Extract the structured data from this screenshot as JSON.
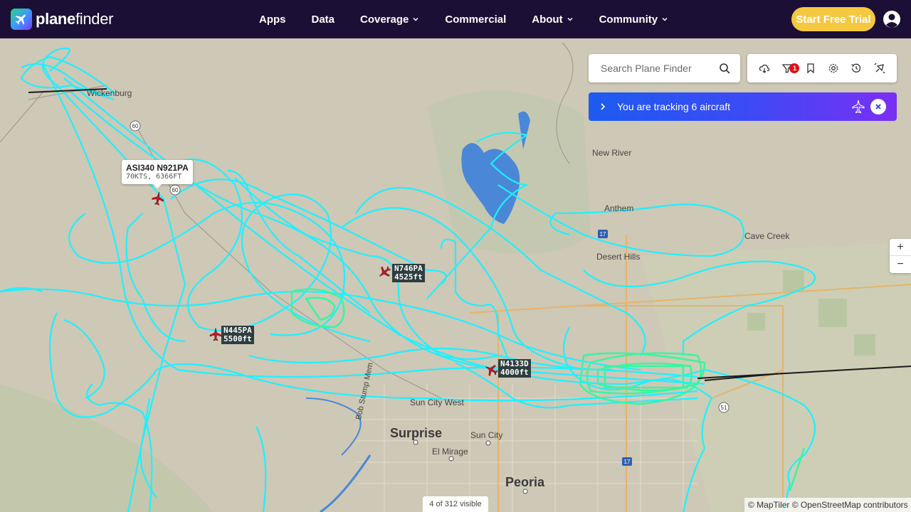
{
  "header": {
    "brand_bold": "plane",
    "brand_light": "finder",
    "nav": [
      {
        "label": "Apps",
        "dropdown": false
      },
      {
        "label": "Data",
        "dropdown": false
      },
      {
        "label": "Coverage",
        "dropdown": true
      },
      {
        "label": "Commercial",
        "dropdown": false
      },
      {
        "label": "About",
        "dropdown": true
      },
      {
        "label": "Community",
        "dropdown": true
      }
    ],
    "cta": "Start Free Trial"
  },
  "search": {
    "placeholder": "Search Plane Finder"
  },
  "toolbar": {
    "icons": [
      "weather-icon",
      "filter-icon",
      "bookmark-icon",
      "settings-icon",
      "history-icon",
      "ar-icon"
    ],
    "filter_badge": "1"
  },
  "tracking": {
    "text": "You are tracking 6 aircraft"
  },
  "zoom": {
    "in": "+",
    "out": "−"
  },
  "status": {
    "visible": "4 of 312 visible"
  },
  "attribution": "© MapTiler © OpenStreetMap contributors",
  "popup": {
    "title": "ASI340 N921PA",
    "detail": "70KTS, 6366FT"
  },
  "aircraft": [
    {
      "callsign": "N746PA",
      "altitude": "4525ft"
    },
    {
      "callsign": "N445PA",
      "altitude": "5500ft"
    },
    {
      "callsign": "N4133D",
      "altitude": "4000ft"
    }
  ],
  "places": [
    {
      "name": "Wickenburg"
    },
    {
      "name": "New River"
    },
    {
      "name": "Anthem"
    },
    {
      "name": "Cave Creek"
    },
    {
      "name": "Desert Hills"
    },
    {
      "name": "Surprise"
    },
    {
      "name": "Sun City"
    },
    {
      "name": "Sun City West"
    },
    {
      "name": "El Mirage"
    },
    {
      "name": "Peoria"
    },
    {
      "name": "Bob Stump Mem"
    }
  ],
  "colors": {
    "header_bg": "#1b0f35",
    "cta": "#f5c842",
    "track_primary": "#1ff0ff",
    "track_secondary": "#3af5a0",
    "plane": "#c0182a",
    "lake": "#4a87d6"
  }
}
